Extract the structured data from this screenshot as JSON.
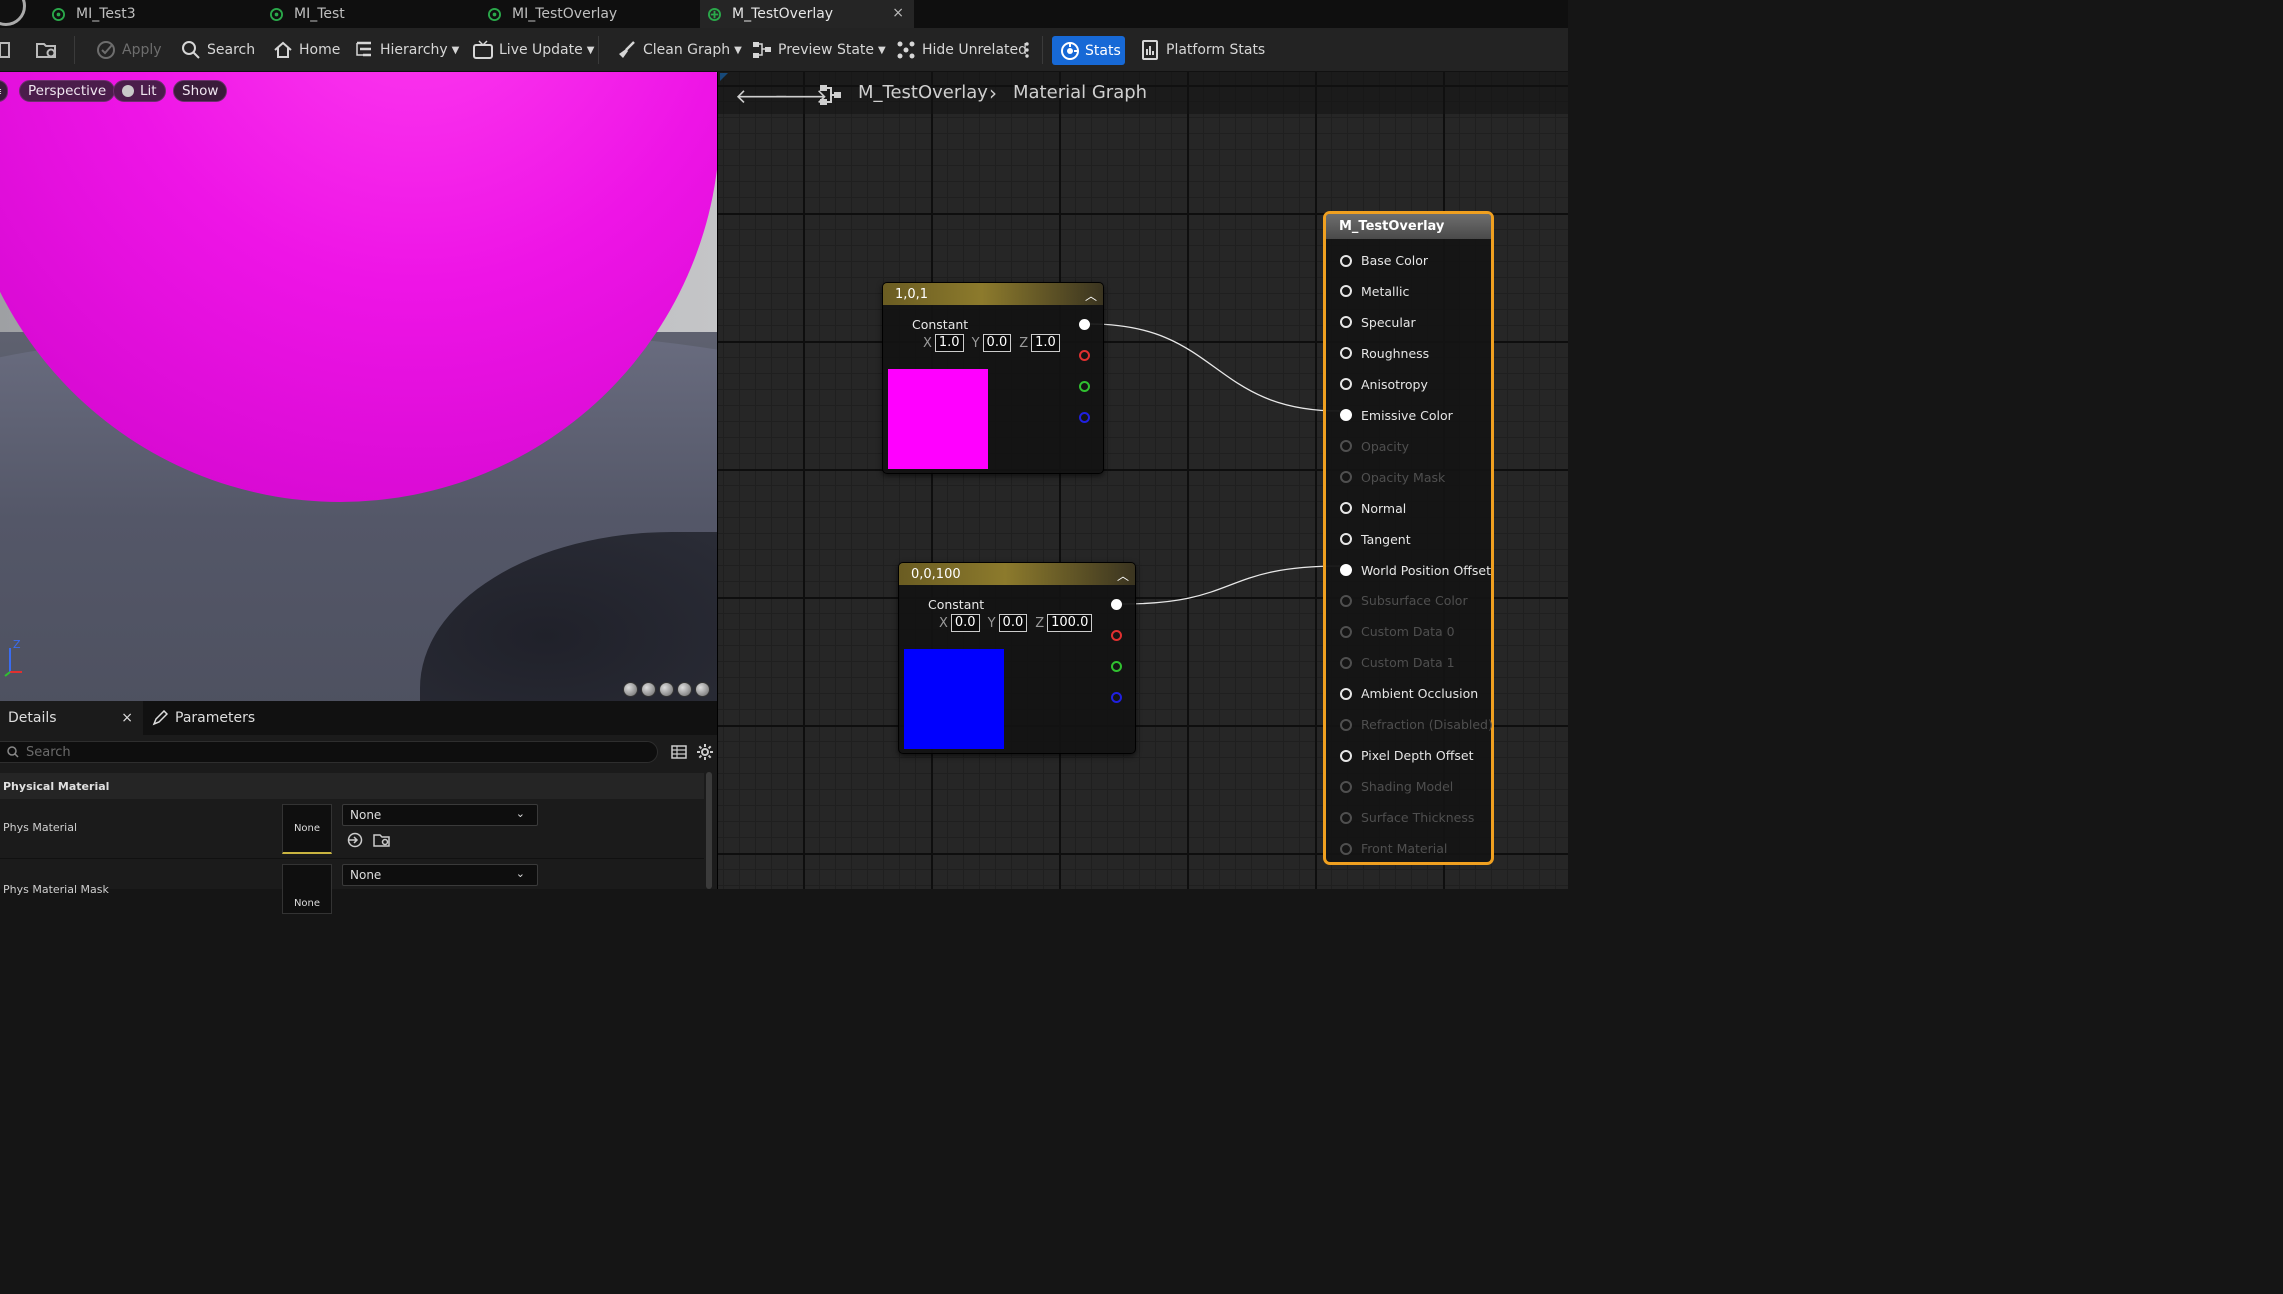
{
  "tabs": [
    {
      "label": "MI_Test3"
    },
    {
      "label": "MI_Test"
    },
    {
      "label": "MI_TestOverlay"
    },
    {
      "label": "M_TestOverlay",
      "close": "×"
    }
  ],
  "toolbar": {
    "apply": "Apply",
    "search": "Search",
    "home": "Home",
    "hierarchy": "Hierarchy",
    "live_update": "Live Update",
    "clean_graph": "Clean Graph",
    "preview_state": "Preview State",
    "hide_unrelated": "Hide Unrelated",
    "stats": "Stats",
    "platform_stats": "Platform Stats"
  },
  "viewport": {
    "perspective": "Perspective",
    "lit": "Lit",
    "show": "Show",
    "axis_z": "Z"
  },
  "details": {
    "tab_details": "Details",
    "tab_close": "×",
    "tab_parameters": "Parameters",
    "search_placeholder": "Search",
    "section": "Physical Material",
    "rows": [
      {
        "label": "Phys Material",
        "thumb": "None",
        "value": "None"
      },
      {
        "label": "Phys Material Mask",
        "thumb": "None",
        "value": "None"
      }
    ]
  },
  "graph": {
    "breadcrumb": [
      "M_TestOverlay",
      "Material Graph"
    ],
    "nodes": [
      {
        "title": "1,0,1",
        "label": "Constant",
        "x": "1.0",
        "y": "0.0",
        "z": "1.0",
        "color": "#ff00ff"
      },
      {
        "title": "0,0,100",
        "label": "Constant",
        "x": "0.0",
        "y": "0.0",
        "z": "100.0",
        "color": "#0000ff"
      }
    ],
    "axis_labels": {
      "x": "X",
      "y": "Y",
      "z": "Z"
    },
    "result": {
      "title": "M_TestOverlay",
      "pins": [
        {
          "label": "Base Color",
          "state": "enabled"
        },
        {
          "label": "Metallic",
          "state": "enabled"
        },
        {
          "label": "Specular",
          "state": "enabled"
        },
        {
          "label": "Roughness",
          "state": "enabled"
        },
        {
          "label": "Anisotropy",
          "state": "enabled"
        },
        {
          "label": "Emissive Color",
          "state": "connected"
        },
        {
          "label": "Opacity",
          "state": "disabled"
        },
        {
          "label": "Opacity Mask",
          "state": "disabled"
        },
        {
          "label": "Normal",
          "state": "enabled"
        },
        {
          "label": "Tangent",
          "state": "enabled"
        },
        {
          "label": "World Position Offset",
          "state": "connected"
        },
        {
          "label": "Subsurface Color",
          "state": "disabled"
        },
        {
          "label": "Custom Data 0",
          "state": "disabled"
        },
        {
          "label": "Custom Data 1",
          "state": "disabled"
        },
        {
          "label": "Ambient Occlusion",
          "state": "enabled"
        },
        {
          "label": "Refraction (Disabled)",
          "state": "disabled"
        },
        {
          "label": "Pixel Depth Offset",
          "state": "enabled"
        },
        {
          "label": "Shading Model",
          "state": "disabled"
        },
        {
          "label": "Surface Thickness",
          "state": "disabled"
        },
        {
          "label": "Front Material",
          "state": "disabled"
        }
      ]
    }
  },
  "colors": {
    "accent": "#1769d6",
    "result_border": "#f0a020",
    "node_header": "#8c7a2c"
  }
}
